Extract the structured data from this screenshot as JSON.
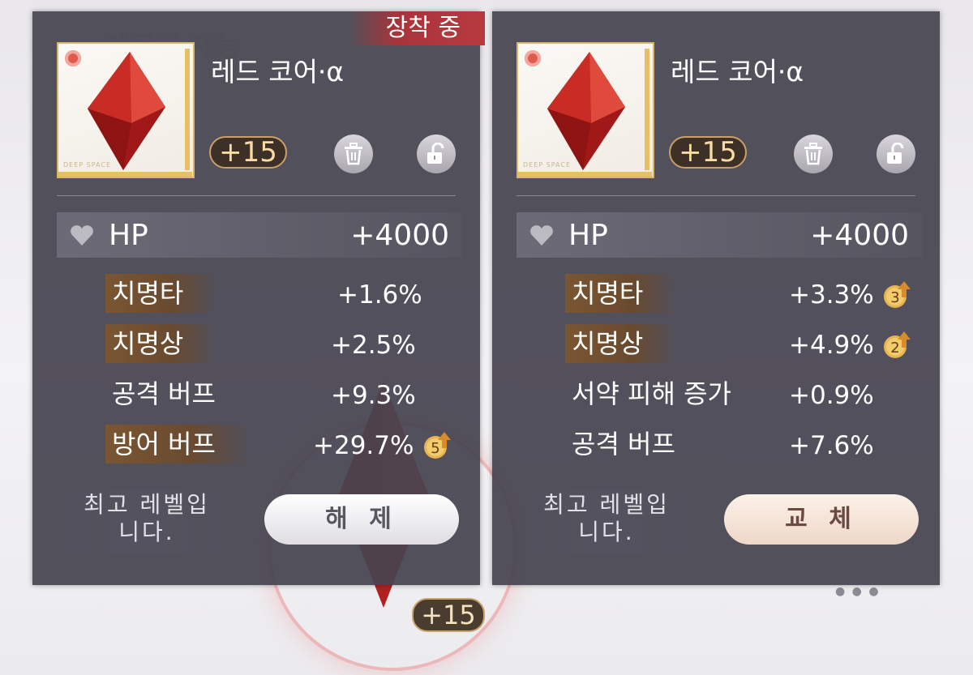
{
  "left_panel": {
    "equipped_tag": "장착 중",
    "item_name": "레드 코어·α",
    "level": "+15",
    "card_brand": "DEEP SPACE",
    "main_stat": {
      "label": "HP",
      "value": "+4000"
    },
    "sub_stats": [
      {
        "label": "치명타",
        "value": "+1.6%",
        "highlight": true
      },
      {
        "label": "치명상",
        "value": "+2.5%",
        "highlight": true
      },
      {
        "label": "공격 버프",
        "value": "+9.3%",
        "highlight": false
      },
      {
        "label": "방어 버프",
        "value": "+29.7%",
        "highlight": true,
        "upgrades": "5"
      }
    ],
    "max_level_text_1": "최고 레벨입",
    "max_level_text_2": "니다.",
    "action_label": "해 제"
  },
  "right_panel": {
    "item_name": "레드 코어·α",
    "level": "+15",
    "card_brand": "DEEP SPACE",
    "main_stat": {
      "label": "HP",
      "value": "+4000"
    },
    "sub_stats": [
      {
        "label": "치명타",
        "value": "+3.3%",
        "highlight": true,
        "upgrades": "3"
      },
      {
        "label": "치명상",
        "value": "+4.9%",
        "highlight": true,
        "upgrades": "2"
      },
      {
        "label": "서약 피해 증가",
        "value": "+0.9%",
        "highlight": false
      },
      {
        "label": "공격 버프",
        "value": "+7.6%",
        "highlight": false
      }
    ],
    "max_level_text_1": "최고 레벨입",
    "max_level_text_2": "니다.",
    "action_label": "교 체"
  },
  "background": {
    "level_badge": "+15"
  },
  "colors": {
    "panel_bg": "#464450",
    "equipped_tag": "#b73a40",
    "highlight_label": "#7a5632",
    "gold_accent": "#d8b868"
  },
  "icons": [
    "trash-icon",
    "unlock-icon",
    "heart-icon",
    "upgrade-arrow-icon",
    "gem-icon"
  ]
}
